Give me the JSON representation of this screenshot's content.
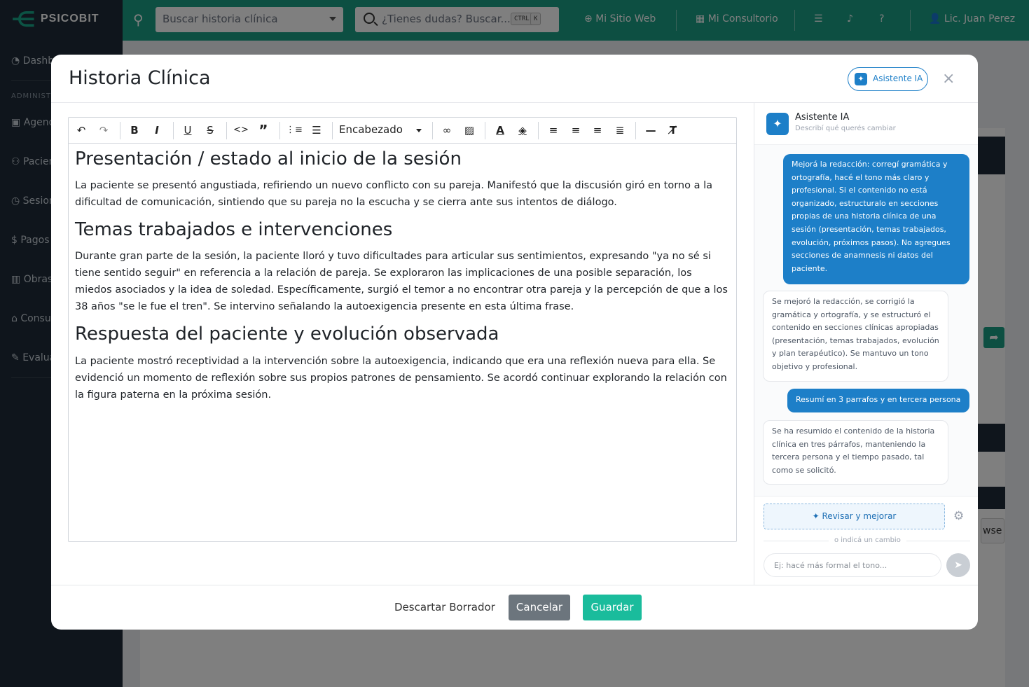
{
  "app": {
    "brand": "PSICOBIT",
    "search_placeholder": "Buscar historia clínica",
    "help_search_placeholder": "¿Tienes dudas? Buscar...",
    "kbd": [
      "CTRL",
      "K"
    ],
    "nav": {
      "site": "Mi Sitio Web",
      "office": "Mi Consultorio",
      "user": "Lic. Juan Perez"
    },
    "sidebar": {
      "section_heading": "ADMINIST",
      "items": [
        "Dashb",
        "Agend",
        "Pacien",
        "Sesion",
        "Pagos",
        "Obras",
        "Consu",
        "Evalua"
      ]
    },
    "bg_button_text": "wse"
  },
  "modal": {
    "title": "Historia Clínica",
    "ai_button_label": "Asistente IA",
    "close_label": "×"
  },
  "editor": {
    "heading_select": "Encabezado",
    "sections": [
      {
        "heading": "Presentación / estado al inicio de la sesión",
        "body": "La paciente se presentó angustiada, refiriendo un nuevo conflicto con su pareja. Manifestó que la discusión giró en torno a la dificultad de comunicación, sintiendo que su pareja no la escucha y se cierra ante sus intentos de diálogo."
      },
      {
        "heading": "Temas trabajados e intervenciones",
        "body": "Durante gran parte de la sesión, la paciente lloró y tuvo dificultades para articular sus sentimientos, expresando \"ya no sé si tiene sentido seguir\" en referencia a la relación de pareja. Se exploraron las implicaciones de una posible separación, los miedos asociados y la idea de soledad. Específicamente, surgió el temor a no encontrar otra pareja y la percepción de que a los 38 años \"se le fue el tren\". Se intervino señalando la autoexigencia presente en esta última frase."
      },
      {
        "heading": "Respuesta del paciente y evolución observada",
        "body": "La paciente mostró receptividad a la intervención sobre la autoexigencia, indicando que era una reflexión nueva para ella. Se evidenció un momento de reflexión sobre sus propios patrones de pensamiento. Se acordó continuar explorando la relación con la figura paterna en la próxima sesión."
      }
    ]
  },
  "footer": {
    "discard": "Descartar Borrador",
    "cancel": "Cancelar",
    "save": "Guardar"
  },
  "assistant": {
    "title": "Asistente IA",
    "subtitle": "Describí qué querés cambiar",
    "messages": [
      {
        "role": "user",
        "text": "Mejorá la redacción: corregí gramática y ortografía, hacé el tono más claro y profesional. Si el contenido no está organizado, estructuralo en secciones propias de una historia clínica de una sesión (presentación, temas trabajados, evolución, próximos pasos). No agregues secciones de anamnesis ni datos del paciente."
      },
      {
        "role": "assistant",
        "text": "Se mejoró la redacción, se corrigió la gramática y ortografía, y se estructuró el contenido en secciones clínicas apropiadas (presentación, temas trabajados, evolución y plan terapéutico). Se mantuvo un tono objetivo y profesional."
      },
      {
        "role": "user",
        "text": "Resumí en 3 parrafos y en tercera persona"
      },
      {
        "role": "assistant",
        "text": "Se ha resumido el contenido de la historia clínica en tres párrafos, manteniendo la tercera persona y el tiempo pasado, tal como se solicitó."
      }
    ],
    "review_button": "Revisar y mejorar",
    "or_text": "o indicá un cambio",
    "input_placeholder": "Ej: hacé más formal el tono..."
  },
  "colors": {
    "accent": "#1d7fc8",
    "topbar": "#1a9e84",
    "save": "#1abc9c",
    "cancel": "#6c757d"
  }
}
